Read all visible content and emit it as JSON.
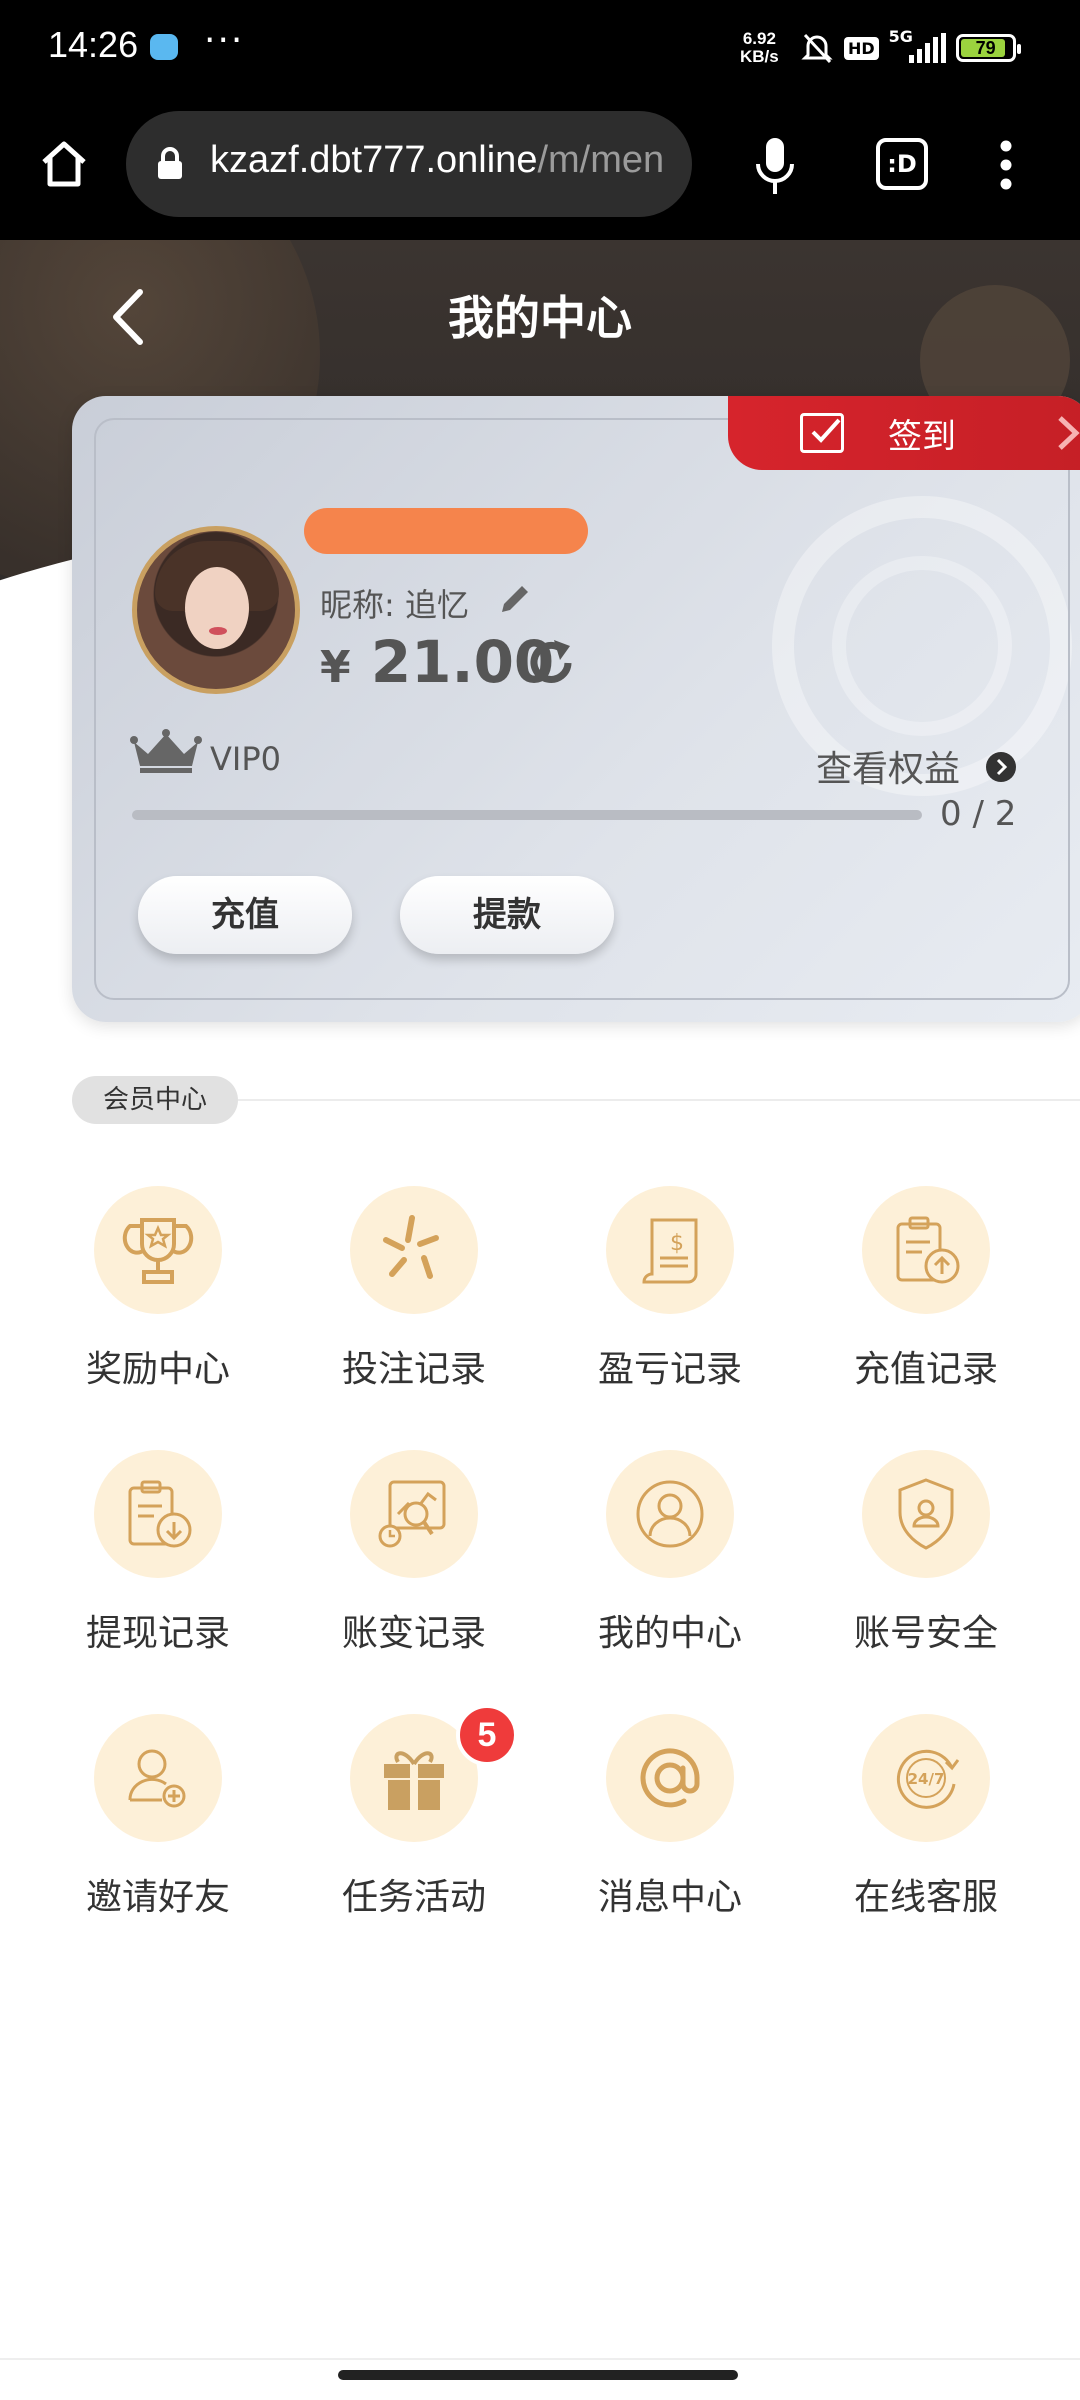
{
  "status_bar": {
    "time": "14:26",
    "more": "···",
    "net_speed": "6.92",
    "net_unit": "KB/s",
    "hd": "HD",
    "signal": "5G",
    "battery": "79"
  },
  "browser": {
    "url_host": "kzazf.dbt777.online",
    "url_path": "/m/men",
    "home_icon": "home-icon",
    "mic_icon": "microphone-icon",
    "tabs_label": ":D",
    "menu_icon": "more-vertical-icon"
  },
  "header": {
    "title": "我的中心",
    "back_icon": "back-arrow-icon"
  },
  "card": {
    "checkin_label": "签到",
    "nickname": "昵称: 追忆",
    "currency": "¥",
    "balance": "21.00",
    "vip_level": "VIP0",
    "rights_label": "查看权益",
    "progress_text": "0 / 2",
    "progress_fraction": 0,
    "recharge_label": "充值",
    "withdraw_label": "提款"
  },
  "section": {
    "title": "会员中心"
  },
  "menu": [
    {
      "label": "奖励中心",
      "icon": "trophy-icon"
    },
    {
      "label": "投注记录",
      "icon": "sparkle-icon"
    },
    {
      "label": "盈亏记录",
      "icon": "receipt-icon"
    },
    {
      "label": "充值记录",
      "icon": "clipboard-upload-icon"
    },
    {
      "label": "提现记录",
      "icon": "clipboard-download-icon"
    },
    {
      "label": "账变记录",
      "icon": "chart-search-icon"
    },
    {
      "label": "我的中心",
      "icon": "user-icon"
    },
    {
      "label": "账号安全",
      "icon": "shield-user-icon"
    },
    {
      "label": "邀请好友",
      "icon": "add-user-icon"
    },
    {
      "label": "任务活动",
      "icon": "gift-icon",
      "badge": "5"
    },
    {
      "label": "消息中心",
      "icon": "at-sign-icon"
    },
    {
      "label": "在线客服",
      "icon": "support-24-7-icon"
    }
  ],
  "colors": {
    "accent": "#c9a061",
    "icon_bg": "#fdf0d8",
    "checkin_red": "#d6242c",
    "badge_red": "#ef3b3b"
  }
}
